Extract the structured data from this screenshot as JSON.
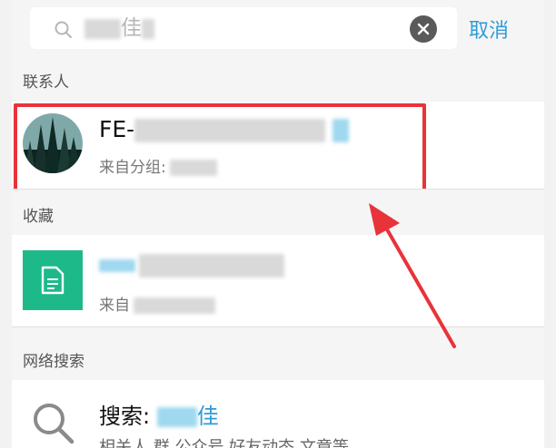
{
  "search": {
    "query_visible": "佳",
    "cancel_label": "取消"
  },
  "sections": {
    "contacts": "联系人",
    "favorites": "收藏",
    "web_search": "网络搜索"
  },
  "contact_result": {
    "name_prefix": "FE-",
    "group_label": "来自分组:"
  },
  "favorite_result": {
    "source_label": "来自"
  },
  "web_result": {
    "title_prefix": "搜索: ",
    "keyword_visible": "佳",
    "categories": "相关人  群  公众号  好友动态  文章等"
  },
  "colors": {
    "accent_blue": "#2f9bd8",
    "highlight_red": "#e8333a",
    "doc_green": "#1db989",
    "section_bg": "#f5f5f5"
  }
}
